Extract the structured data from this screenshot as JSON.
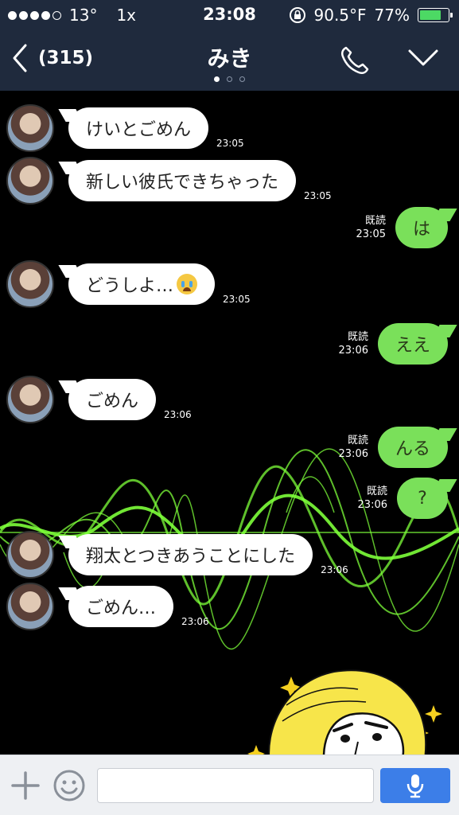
{
  "status_bar": {
    "carrier": "13°",
    "scale": "1x",
    "time": "23:08",
    "temperature": "90.5°F",
    "battery": "77%",
    "battery_level": 0.77
  },
  "header": {
    "back_label": "(315)",
    "title": "みき",
    "page_count": 3,
    "active_page": 1
  },
  "messages": [
    {
      "side": "in",
      "text": "けいとごめん",
      "time": "23:05"
    },
    {
      "side": "in",
      "text": "新しい彼氏できちゃった",
      "time": "23:05"
    },
    {
      "side": "out",
      "text": "は",
      "read": "既読",
      "time": "23:05"
    },
    {
      "side": "in",
      "text": "どうしよ…",
      "emoji": "crying-face",
      "time": "23:05"
    },
    {
      "side": "out",
      "text": "ええ",
      "read": "既読",
      "time": "23:06"
    },
    {
      "side": "in",
      "text": "ごめん",
      "time": "23:06"
    },
    {
      "side": "out",
      "text": "んる",
      "read": "既読",
      "time": "23:06"
    },
    {
      "side": "out",
      "text": "?",
      "read": "既読",
      "time": "23:06"
    },
    {
      "side": "in",
      "text": "翔太とつきあうことにした",
      "time": "23:06"
    },
    {
      "side": "in",
      "text": "ごめん…",
      "time": "23:06"
    }
  ],
  "input": {
    "value": "",
    "placeholder": ""
  },
  "colors": {
    "header_bg": "#1f2a3d",
    "out_bubble": "#7ae05a",
    "in_bubble": "#ffffff",
    "mic_button": "#3c7ee8",
    "battery_fill": "#4cd964"
  },
  "icons": [
    "back-chevron-icon",
    "phone-icon",
    "chevron-down-icon",
    "plus-icon",
    "smiley-icon",
    "microphone-icon",
    "orientation-lock-icon",
    "battery-icon"
  ]
}
